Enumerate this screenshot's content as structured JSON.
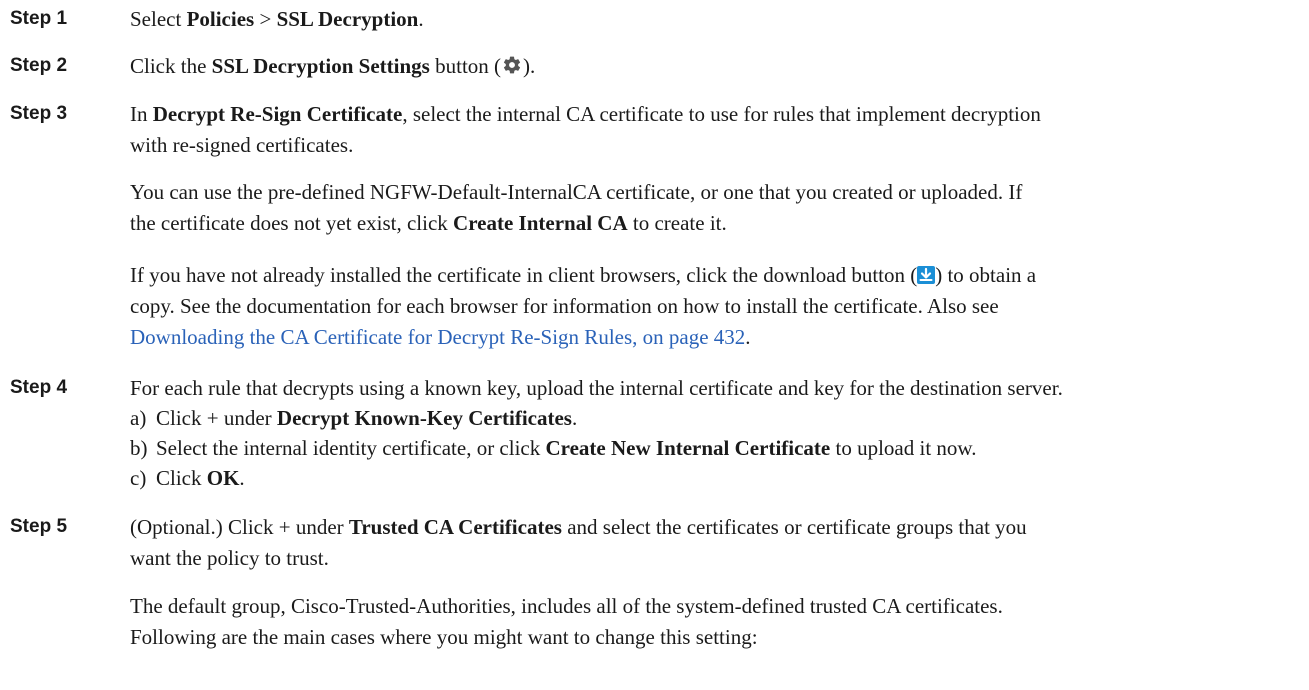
{
  "steps": [
    {
      "label": "Step 1",
      "text": {
        "a": "Select ",
        "b1": "Policies",
        "c": " > ",
        "b2": "SSL Decryption",
        "d": "."
      }
    },
    {
      "label": "Step 2",
      "text": {
        "a": "Click the ",
        "b1": "SSL Decryption Settings",
        "c": " button (",
        "icon": "gear-icon",
        "d": ")."
      }
    },
    {
      "label": "Step 3",
      "line1": {
        "a": "In ",
        "b1": "Decrypt Re-Sign Certificate",
        "c": ", select the internal CA certificate to use for rules that implement decryption"
      },
      "line2": "with re-signed certificates.",
      "p2": {
        "line1": "You can use the pre-defined NGFW-Default-InternalCA certificate, or one that you created or uploaded. If",
        "line2a": "the certificate does not yet exist, click ",
        "line2b": "Create Internal CA",
        "line2c": " to create it."
      },
      "p3": {
        "line1a": "If you have not already installed the certificate in client browsers, click the download button (",
        "icon": "download-icon",
        "line1b": ") to obtain a",
        "line2": "copy. See the documentation for each browser for information on how to install the certificate. Also see",
        "link": "Downloading the CA Certificate for Decrypt Re-Sign Rules, on page 432",
        "link_end": "."
      }
    },
    {
      "label": "Step 4",
      "text": "For each rule that decrypts using a known key, upload the internal certificate and key for the destination server.",
      "subs": [
        {
          "letter": "a)",
          "a": "Click + under ",
          "b": "Decrypt Known-Key Certificates",
          "c": "."
        },
        {
          "letter": "b)",
          "a": "Select the internal identity certificate, or click ",
          "b": "Create New Internal Certificate",
          "c": " to upload it now."
        },
        {
          "letter": "c)",
          "a": "Click ",
          "b": "OK",
          "c": "."
        }
      ]
    },
    {
      "label": "Step 5",
      "line1": {
        "a": "(Optional.) Click + under ",
        "b": "Trusted CA Certificates",
        "c": " and select the certificates or certificate groups that you"
      },
      "line2": "want the policy to trust.",
      "p2": {
        "line1": "The default group, Cisco-Trusted-Authorities, includes all of the system-defined trusted CA certificates.",
        "line2": "Following are the main cases where you might want to change this setting:"
      }
    }
  ],
  "colors": {
    "link": "#2a62b8",
    "download_icon": "#1b8fd6"
  }
}
